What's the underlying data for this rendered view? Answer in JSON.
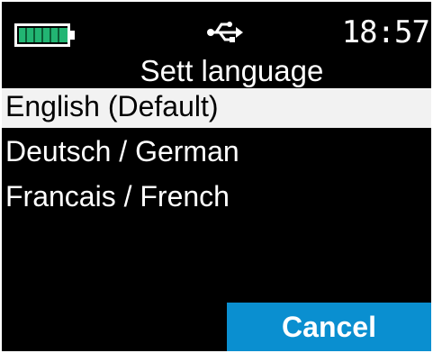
{
  "status_bar": {
    "battery_icon": "battery-full-icon",
    "battery_level": 1.0,
    "usb_icon": "usb-icon",
    "time": "18:57"
  },
  "screen": {
    "title": "Sett language",
    "items": [
      {
        "label": "English (Default)",
        "selected": true
      },
      {
        "label": "Deutsch / German",
        "selected": false
      },
      {
        "label": "Francais / French",
        "selected": false
      }
    ]
  },
  "softkeys": {
    "cancel_label": "Cancel"
  },
  "colors": {
    "background": "#000000",
    "selection_bg": "#f2f2f2",
    "accent": "#0a8fd0",
    "battery": "#22b573"
  }
}
